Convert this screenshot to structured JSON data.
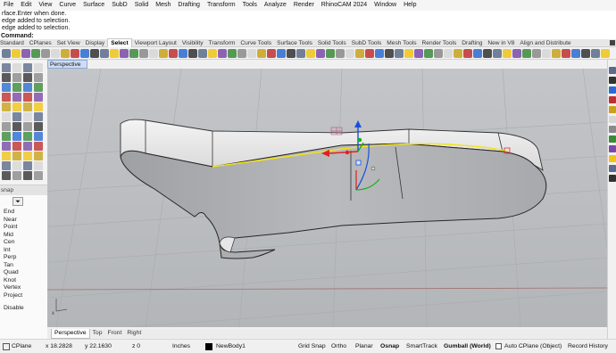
{
  "menu": [
    "File",
    "Edit",
    "View",
    "Curve",
    "Surface",
    "SubD",
    "Solid",
    "Mesh",
    "Drafting",
    "Transform",
    "Tools",
    "Analyze",
    "Render",
    "RhinoCAM 2024",
    "Window",
    "Help"
  ],
  "command_history": {
    "line1": "rface.Enter when done.",
    "line2": "edge added to selection.",
    "line3": "edge added to selection.",
    "prompt": "Command:"
  },
  "toolbar_tabs": [
    "Standard",
    "CPlanes",
    "Set View",
    "Display",
    "Select",
    "Viewport Layout",
    "Visibility",
    "Transform",
    "Curve Tools",
    "Surface Tools",
    "Solid Tools",
    "SubD Tools",
    "Mesh Tools",
    "Render Tools",
    "Drafting",
    "New in V8",
    "Align and Distribute"
  ],
  "active_tab": "Select",
  "osnap": {
    "title": "snap",
    "items": [
      "End",
      "Near",
      "Point",
      "Mid",
      "Cen",
      "Int",
      "Perp",
      "Tan",
      "Quad",
      "Knot",
      "Vertex",
      "Project",
      "Disable"
    ]
  },
  "viewport": {
    "label": "Perspective",
    "dropdown_glyph": "▾"
  },
  "view_tabs": [
    "Perspective",
    "Top",
    "Front",
    "Right"
  ],
  "status": {
    "cplane": "CPlane",
    "x": "x 18.2828",
    "y": "y 22.1630",
    "z": "z 0",
    "units": "Inches",
    "layer": "NewBody1",
    "grid_snap": "Grid Snap",
    "ortho": "Ortho",
    "planar": "Planar",
    "osnap": "Osnap",
    "smarttrack": "SmartTrack",
    "gumball": "Gumball (World)",
    "auto_cplane": "Auto CPlane (Object)",
    "record_history": "Record History"
  },
  "colors": {
    "viewport_bg": "#bcbec1",
    "selection_curve": "#f2e21a",
    "gumball_x": "#e02020",
    "gumball_y": "#18b018",
    "gumball_z": "#1a50d8"
  }
}
